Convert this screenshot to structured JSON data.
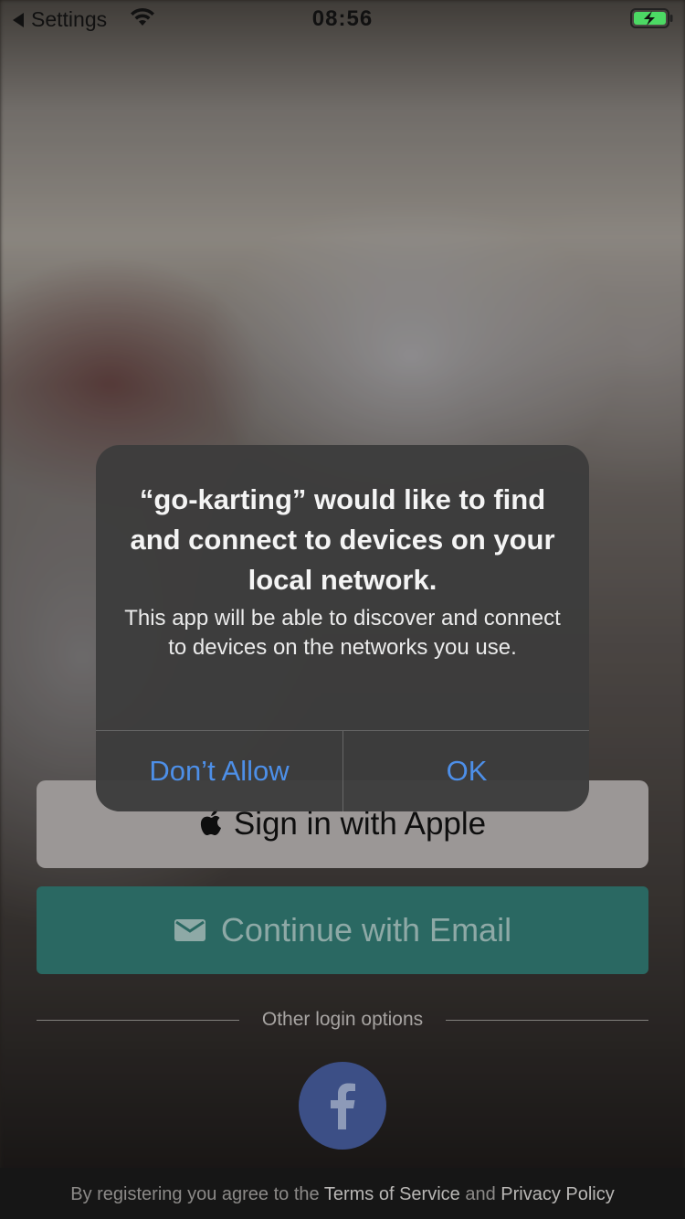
{
  "status_bar": {
    "back_label": "Settings",
    "time": "08:56",
    "battery_color": "#4cd964"
  },
  "alert": {
    "title": "“go-karting” would like to find and connect to devices on your local network.",
    "message": "This app will be able to discover and connect to devices on the networks you use.",
    "cancel_label": "Don’t Allow",
    "ok_label": "OK",
    "button_color": "#4d8fe8"
  },
  "login": {
    "apple_label": "Sign in with Apple",
    "email_label": "Continue with Email",
    "other_options_label": "Other login options",
    "facebook_icon": "facebook-icon",
    "email_color": "#2a6862"
  },
  "footer": {
    "prefix": "By registering you agree to the ",
    "terms_label": "Terms of Service",
    "conjunction": " and ",
    "privacy_label": "Privacy Policy"
  }
}
